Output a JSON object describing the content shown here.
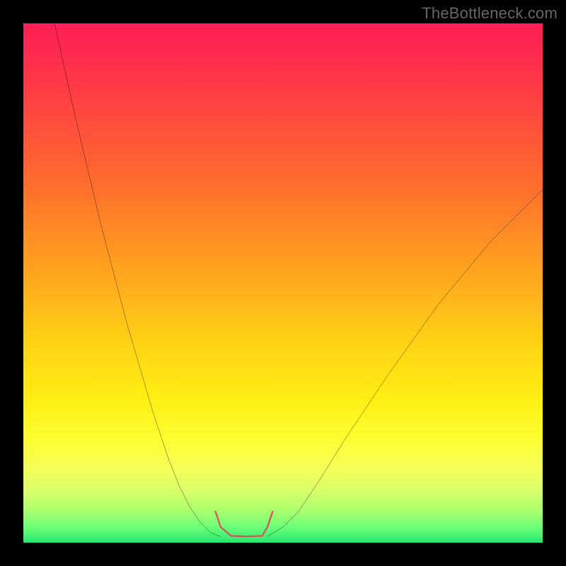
{
  "watermark": "TheBottleneck.com",
  "chart_data": {
    "type": "line",
    "title": "",
    "xlabel": "",
    "ylabel": "",
    "xlim": [
      0,
      100
    ],
    "ylim": [
      0,
      100
    ],
    "series": [
      {
        "name": "left-curve",
        "x": [
          6,
          10,
          15,
          20,
          25,
          28,
          30,
          32,
          34,
          36,
          37,
          38
        ],
        "y": [
          100,
          82,
          61,
          42,
          25,
          16,
          11,
          7,
          4,
          2,
          1.5,
          1.2
        ]
      },
      {
        "name": "right-curve",
        "x": [
          47,
          48,
          50,
          53,
          57,
          62,
          70,
          80,
          90,
          100
        ],
        "y": [
          1.2,
          1.8,
          3,
          6,
          12,
          20,
          32,
          46,
          58,
          68
        ]
      },
      {
        "name": "valley-highlight",
        "x": [
          37,
          38,
          40,
          43,
          46,
          47,
          48
        ],
        "y": [
          6,
          3,
          1.3,
          1.2,
          1.3,
          3,
          6
        ]
      }
    ],
    "colors": {
      "curve": "#000000",
      "highlight": "#d15a62"
    }
  }
}
